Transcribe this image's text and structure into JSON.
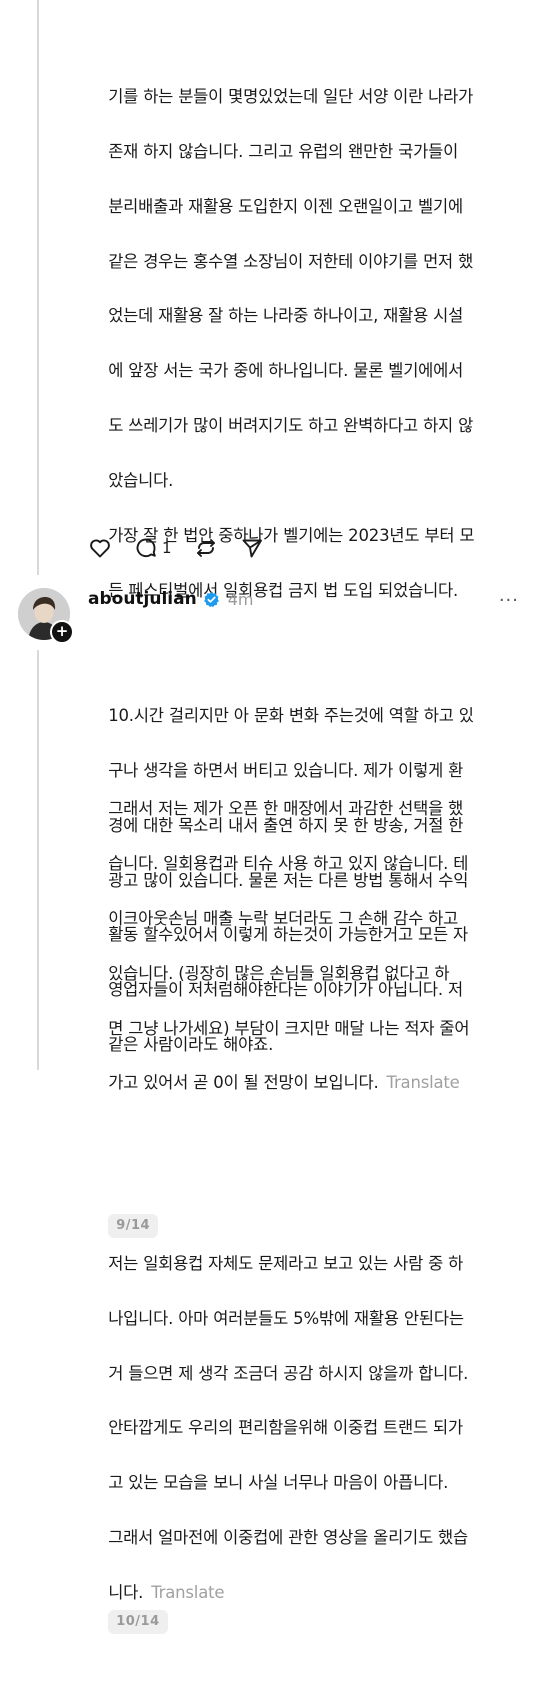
{
  "post1": {
    "paragraphs": [
      [
        "기를 하는 분들이 몇명있었는데 일단 서양 이란 나라가",
        "존재 하지 않습니다. 그리고 유럽의 왠만한 국가들이",
        "분리배출과 재활용 도입한지 이젠 오랜일이고 벨기에",
        "같은 경우는 홍수열 소장님이 저한테 이야기를 먼저 했",
        "었는데 재활용 잘 하는 나라중 하나이고, 재활용 시설",
        "에 앞장 서는 국가 중에 하나입니다. 물론 벨기에에서",
        "도 쓰레기가 많이 버려지기도 하고 완벽하다고 하지 않",
        "았습니다.",
        "가장 잘 한 법안 중하나가 벨기에는 2023년도 부터 모",
        "든 페스티벌에서 일회용컵 금지 법 도입 되었습니다."
      ],
      [
        "그래서 저는 제가 오픈 한 매장에서 과감한 선택을 했",
        "습니다. 일회용컵과 티슈 사용 하고 있지 않습니다. 테",
        "이크아웃손님 매출 누락 보더라도 그 손해 감수 하고",
        "있습니다. (굉장히 많은 손님들 일회용컵 없다고 하",
        "면 그냥 나가세요) 부담이 크지만 매달 나는 적자 줄어",
        "가고 있어서 곧 0이 될 전망이 보입니다."
      ]
    ],
    "translate": "Translate",
    "page": "9/14",
    "reply_count": "1"
  },
  "post2": {
    "username": "aboutjulian",
    "time": "4m",
    "more": "···",
    "paragraphs": [
      [
        "10.시간 걸리지만 아 문화 변화 주는것에 역할 하고 있",
        "구나 생각을 하면서 버티고 있습니다. 제가 이렇게 환",
        "경에 대한 목소리 내서 출연 하지 못 한 방송, 거절 한",
        "광고 많이 있습니다. 물론 저는 다른 방법 통해서 수익",
        "활동 할수있어서 이렇게 하는것이 가능한거고 모든 자",
        "영업자들이 저처럼해야한다는 이야기가 아닙니다. 저",
        "같은 사람이라도 해야죠."
      ],
      [
        "저는 일회용컵 자체도 문제라고 보고 있는 사람 중 하",
        "나입니다. 아마 여러분들도 5%밖에 재활용 안된다는",
        "거 들으면 제 생각 조금더 공감 하시지 않을까 합니다.",
        "안타깝게도 우리의 편리함을위해 이중컵 트랜드 되가",
        "고 있는 모습을 보니 사실 너무나 마음이 아픕니다.",
        "그래서 얼마전에 이중컵에 관한 영상을 올리기도 했습",
        "니다."
      ]
    ],
    "translate": "Translate",
    "page": "10/14"
  },
  "icons": {
    "like": "heart-icon",
    "reply": "comment-icon",
    "repost": "repost-icon",
    "share": "send-icon",
    "verified": "verified-badge-icon",
    "follow": "plus-icon"
  },
  "colors": {
    "verified": "#1d9bf0",
    "muted": "#a0a0a0"
  }
}
